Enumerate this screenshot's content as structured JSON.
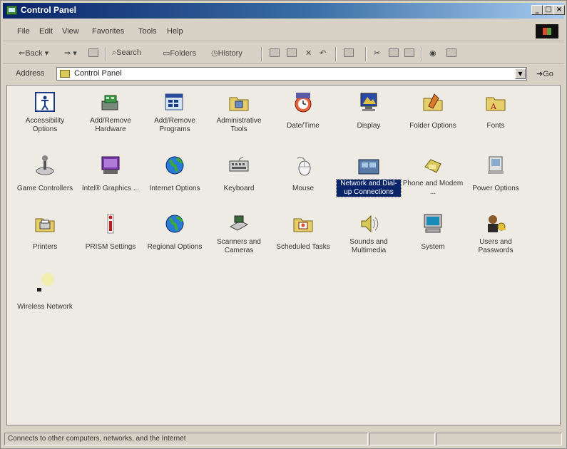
{
  "window": {
    "title": "Control Panel",
    "min": "_",
    "max": "□",
    "close": "×"
  },
  "menu": [
    "File",
    "Edit",
    "View",
    "Favorites",
    "Tools",
    "Help"
  ],
  "toolbar": {
    "back": "Back",
    "search": "Search",
    "folders": "Folders",
    "history": "History"
  },
  "address": {
    "label": "Address",
    "value": "Control Panel",
    "go": "Go"
  },
  "items": [
    {
      "label": "Accessibility Options",
      "icon": "accessibility-icon",
      "selected": false
    },
    {
      "label": "Add/Remove Hardware",
      "icon": "hardware-icon",
      "selected": false
    },
    {
      "label": "Add/Remove Programs",
      "icon": "programs-icon",
      "selected": false
    },
    {
      "label": "Administrative Tools",
      "icon": "admin-tools-icon",
      "selected": false
    },
    {
      "label": "Date/Time",
      "icon": "clock-icon",
      "selected": false
    },
    {
      "label": "Display",
      "icon": "display-icon",
      "selected": false
    },
    {
      "label": "Folder Options",
      "icon": "folder-options-icon",
      "selected": false
    },
    {
      "label": "Fonts",
      "icon": "fonts-icon",
      "selected": false
    },
    {
      "label": "Game Controllers",
      "icon": "joystick-icon",
      "selected": false
    },
    {
      "label": "Intel® Graphics ...",
      "icon": "intel-graphics-icon",
      "selected": false
    },
    {
      "label": "Internet Options",
      "icon": "globe-icon",
      "selected": false
    },
    {
      "label": "Keyboard",
      "icon": "keyboard-icon",
      "selected": false
    },
    {
      "label": "Mouse",
      "icon": "mouse-icon",
      "selected": false
    },
    {
      "label": "Network and Dial-up Connections",
      "icon": "network-icon",
      "selected": true
    },
    {
      "label": "Phone and Modem ...",
      "icon": "phone-icon",
      "selected": false
    },
    {
      "label": "Power Options",
      "icon": "power-icon",
      "selected": false
    },
    {
      "label": "Printers",
      "icon": "printer-icon",
      "selected": false
    },
    {
      "label": "PRISM Settings",
      "icon": "prism-icon",
      "selected": false
    },
    {
      "label": "Regional Options",
      "icon": "globe-icon",
      "selected": false
    },
    {
      "label": "Scanners and Cameras",
      "icon": "scanner-icon",
      "selected": false
    },
    {
      "label": "Scheduled Tasks",
      "icon": "scheduled-tasks-icon",
      "selected": false
    },
    {
      "label": "Sounds and Multimedia",
      "icon": "speaker-icon",
      "selected": false
    },
    {
      "label": "System",
      "icon": "computer-icon",
      "selected": false
    },
    {
      "label": "Users and Passwords",
      "icon": "users-icon",
      "selected": false
    },
    {
      "label": "Wireless Network",
      "icon": "wireless-icon",
      "selected": false
    }
  ],
  "status": {
    "text": "Connects to other computers, networks, and the Internet"
  },
  "colors": {
    "selection": "#0a246a",
    "titlebar": "#0a246a"
  }
}
